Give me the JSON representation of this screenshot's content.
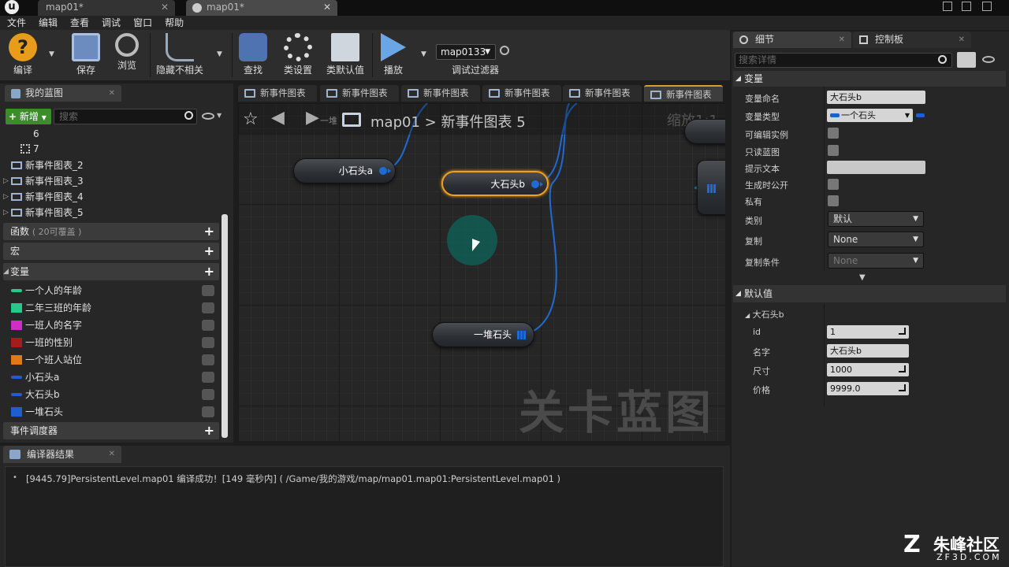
{
  "window": {
    "tabs": [
      "map01*",
      "map01*"
    ]
  },
  "menu": [
    "文件",
    "编辑",
    "查看",
    "调试",
    "窗口",
    "帮助"
  ],
  "toolbar": {
    "compile": "编译",
    "save": "保存",
    "browse": "浏览",
    "hide_unrelated": "隐藏不相关",
    "find": "查找",
    "class_settings": "类设置",
    "class_defaults": "类默认值",
    "play": "播放",
    "debug_select": "map0133",
    "debug_filter": "调试过滤器"
  },
  "my_blueprint": {
    "title": "我的蓝图",
    "new_btn": "新增",
    "search_placeholder": "搜索",
    "tree": [
      "6",
      "7",
      "新事件图表_2",
      "新事件图表_3",
      "新事件图表_4",
      "新事件图表_5"
    ],
    "sections": {
      "functions": "函数",
      "functions_note": "( 20可覆盖 )",
      "macros": "宏",
      "variables": "变量",
      "dispatchers": "事件调度器"
    },
    "variables": [
      {
        "name": "一个人的年龄",
        "color": "#28c88c"
      },
      {
        "name": "二年三班的年龄",
        "color": "#28c88c"
      },
      {
        "name": "一班人的名字",
        "color": "#d02cc7"
      },
      {
        "name": "一班的性别",
        "color": "#a51c1c"
      },
      {
        "name": "一个班人站位",
        "color": "#e07a18"
      },
      {
        "name": "小石头a",
        "color": "#1e5fd0"
      },
      {
        "name": "大石头b",
        "color": "#1e5fd0"
      },
      {
        "name": "一堆石头",
        "color": "#1e5fd0"
      }
    ]
  },
  "graph": {
    "tabs": [
      "新事件图表",
      "新事件图表",
      "新事件图表",
      "新事件图表",
      "新事件图表",
      "新事件图表"
    ],
    "breadcrumb": {
      "root": "map01",
      "sep": ">",
      "current": "新事件图表 5",
      "zoom": "缩放1:1",
      "prev": "一堆"
    },
    "nodes": {
      "small": "小石头a",
      "big": "大石头b",
      "pile": "一堆石头"
    },
    "watermark": "关卡蓝图"
  },
  "details": {
    "tab1": "细节",
    "tab2": "控制板",
    "search_placeholder": "搜索详情",
    "variable_section": "变量",
    "rows": {
      "var_name": "变量命名",
      "var_name_val": "大石头b",
      "var_type": "变量类型",
      "var_type_val": "一个石头",
      "editable": "可编辑实例",
      "readonly": "只读蓝图",
      "tooltip": "提示文本",
      "expose": "生成时公开",
      "private": "私有",
      "category": "类别",
      "category_val": "默认",
      "replication": "复制",
      "replication_val": "None",
      "rep_cond": "复制条件",
      "rep_cond_val": "None"
    },
    "default_section": "默认值",
    "default": {
      "struct": "大石头b",
      "id": "id",
      "id_val": "1",
      "name": "名字",
      "name_val": "大石头b",
      "size": "尺寸",
      "size_val": "1000",
      "price": "价格",
      "price_val": "9999.0"
    }
  },
  "compiler": {
    "tab": "编译器结果",
    "log": "[9445.79]PersistentLevel.map01 编译成功！[149 毫秒内] ( /Game/我的游戏/map/map01.map01:PersistentLevel.map01 )"
  },
  "brand": {
    "name": "朱峰社区",
    "domain": "ZF3D.COM"
  }
}
